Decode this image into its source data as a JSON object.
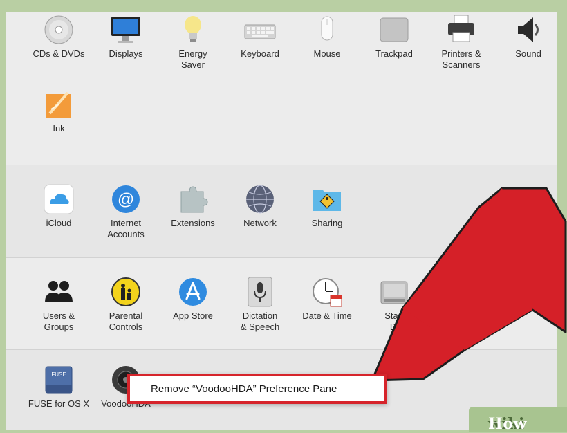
{
  "rows": {
    "hardware": [
      {
        "label": "CDs & DVDs",
        "icon": "cd-dvd-icon"
      },
      {
        "label": "Displays",
        "icon": "display-icon"
      },
      {
        "label": "Energy\nSaver",
        "icon": "lightbulb-icon"
      },
      {
        "label": "Keyboard",
        "icon": "keyboard-icon"
      },
      {
        "label": "Mouse",
        "icon": "mouse-icon"
      },
      {
        "label": "Trackpad",
        "icon": "trackpad-icon"
      },
      {
        "label": "Printers &\nScanners",
        "icon": "printer-icon"
      },
      {
        "label": "Sound",
        "icon": "speaker-icon"
      },
      {
        "label": "Ink",
        "icon": "ink-icon"
      }
    ],
    "internet": [
      {
        "label": "iCloud",
        "icon": "icloud-icon"
      },
      {
        "label": "Internet\nAccounts",
        "icon": "at-sign-icon"
      },
      {
        "label": "Extensions",
        "icon": "puzzle-piece-icon"
      },
      {
        "label": "Network",
        "icon": "globe-network-icon"
      },
      {
        "label": "Sharing",
        "icon": "sharing-folder-icon"
      }
    ],
    "system": [
      {
        "label": "Users &\nGroups",
        "icon": "users-icon"
      },
      {
        "label": "Parental\nControls",
        "icon": "parental-controls-icon"
      },
      {
        "label": "App Store",
        "icon": "app-store-icon"
      },
      {
        "label": "Dictation\n& Speech",
        "icon": "microphone-icon"
      },
      {
        "label": "Date & Time",
        "icon": "clock-calendar-icon"
      },
      {
        "label": "Start\nDi",
        "icon": "startup-disk-icon"
      },
      {
        "label": "",
        "icon": "accessibility-icon"
      }
    ],
    "other": [
      {
        "label": "FUSE for OS X",
        "icon": "fuse-drive-icon"
      },
      {
        "label": "VoodooHDA",
        "icon": "voodoohda-speaker-icon"
      }
    ]
  },
  "context_menu": {
    "item": "Remove “VoodooHDA” Preference Pane"
  },
  "watermark": {
    "prefix": "wiki",
    "suffix": "How"
  },
  "colors": {
    "highlight": "#d6242b",
    "arrow": "#d52028"
  }
}
